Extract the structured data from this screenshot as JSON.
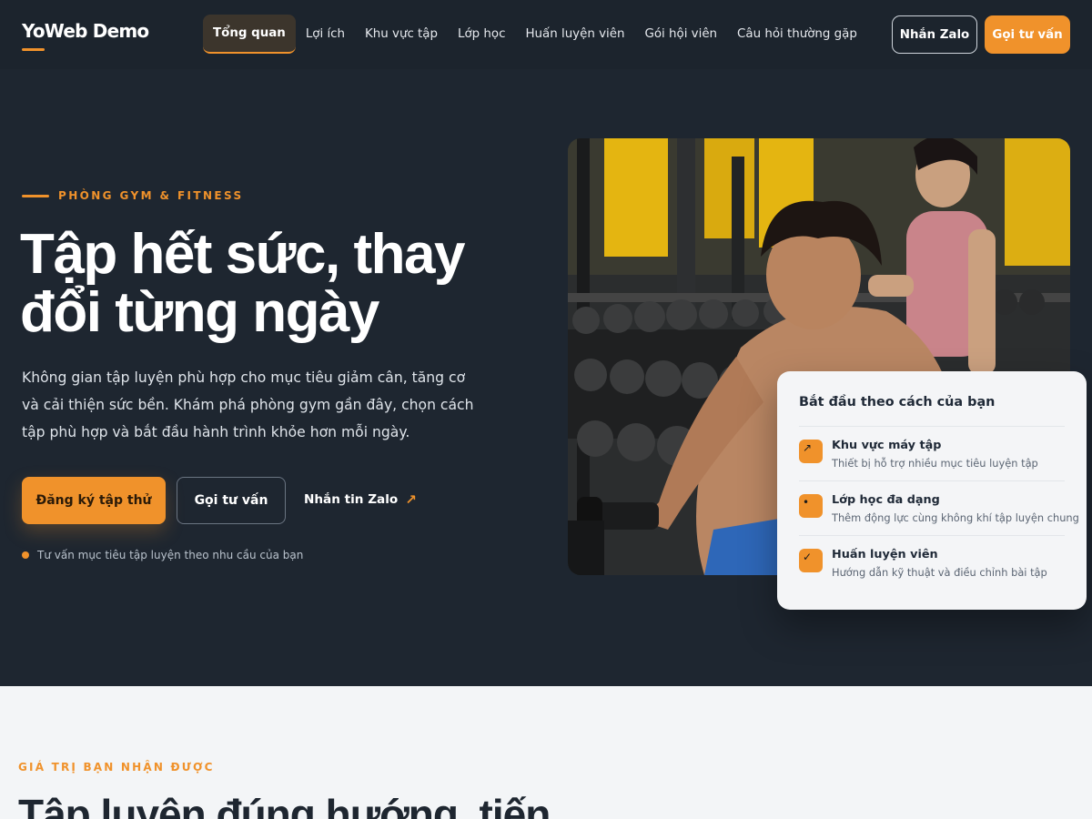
{
  "nav": {
    "logo": "YoWeb Demo",
    "links": [
      "Tổng quan",
      "Lợi ích",
      "Khu vực tập",
      "Lớp học",
      "Huấn luyện viên",
      "Gói hội viên",
      "Câu hỏi thường gặp"
    ],
    "active_index": 0,
    "zalo_button": "Nhắn Zalo",
    "call_button": "Gọi tư vấn"
  },
  "hero": {
    "eyebrow": "PHÒNG GYM & FITNESS",
    "title": "Tập hết sức, thay đổi từng ngày",
    "description": "Không gian tập luyện phù hợp cho mục tiêu giảm cân, tăng cơ và cải thiện sức bền. Khám phá phòng gym gần đây, chọn cách tập phù hợp và bắt đầu hành trình khỏe hơn mỗi ngày.",
    "primary_button": "Đăng ký tập thử",
    "outline_button": "Gọi tư vấn",
    "zalo_link": "Nhắn tin Zalo",
    "note": "Tư vấn mục tiêu tập luyện theo nhu cầu của bạn"
  },
  "card": {
    "title": "Bắt đầu theo cách của bạn",
    "items": [
      {
        "title": "Khu vực máy tập",
        "desc": "Thiết bị hỗ trợ nhiều mục tiêu luyện tập",
        "icon": "arrow-up-right-icon",
        "glyph": "↗"
      },
      {
        "title": "Lớp học đa dạng",
        "desc": "Thêm động lực cùng không khí tập luyện chung",
        "icon": "dot-icon",
        "glyph": "•"
      },
      {
        "title": "Huấn luyện viên",
        "desc": "Hướng dẫn kỹ thuật và điều chỉnh bài tập",
        "icon": "check-icon",
        "glyph": "✓"
      }
    ]
  },
  "section2": {
    "eyebrow": "GIÁ TRỊ BẠN NHẬN ĐƯỢC",
    "title": "Tập luyện đúng hướng, tiến"
  },
  "colors": {
    "accent": "#f0922b",
    "dark_bg": "#1e2630",
    "light_bg": "#f3f5f7"
  }
}
